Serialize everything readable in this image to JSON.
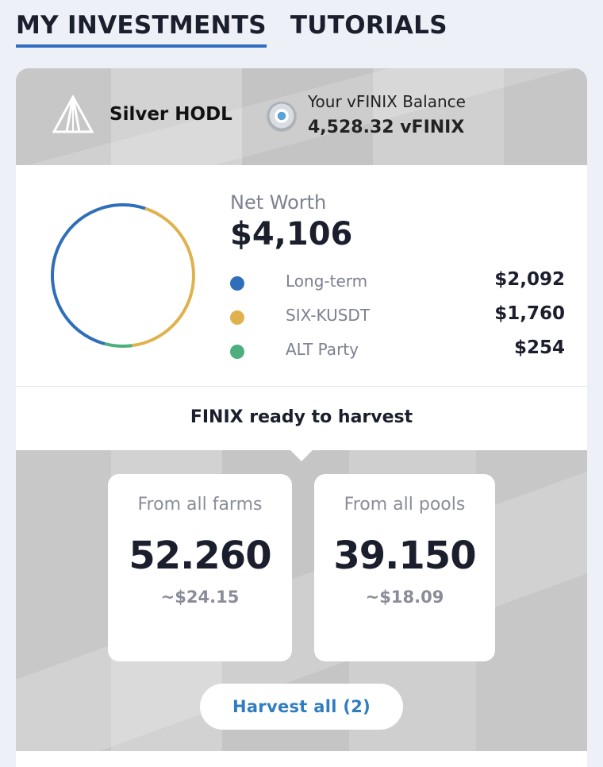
{
  "tabs": [
    {
      "label": "MY INVESTMENTS",
      "active": true
    },
    {
      "label": "TUTORIALS",
      "active": false
    }
  ],
  "header": {
    "rank_icon": "prism-rank-icon",
    "rank_name": "Silver HODL",
    "coin_icon": "vfinix-coin-icon",
    "balance_label": "Your vFINIX Balance",
    "balance_value": "4,528.32 vFINIX"
  },
  "networth": {
    "label": "Net Worth",
    "value": "$4,106",
    "items": [
      {
        "name": "Long-term",
        "value": "$2,092",
        "amount": 2092,
        "color": "#2f6fba"
      },
      {
        "name": "SIX-KUSDT",
        "value": "$1,760",
        "amount": 1760,
        "color": "#e0b24e"
      },
      {
        "name": "ALT Party",
        "value": "$254",
        "amount": 254,
        "color": "#4caf7d"
      }
    ]
  },
  "harvest": {
    "title": "FINIX ready to harvest",
    "farms": {
      "label": "From all farms",
      "value": "52.260",
      "usd": "~$24.15"
    },
    "pools": {
      "label": "From all pools",
      "value": "39.150",
      "usd": "~$18.09"
    },
    "button_label": "Harvest all (2)"
  }
}
